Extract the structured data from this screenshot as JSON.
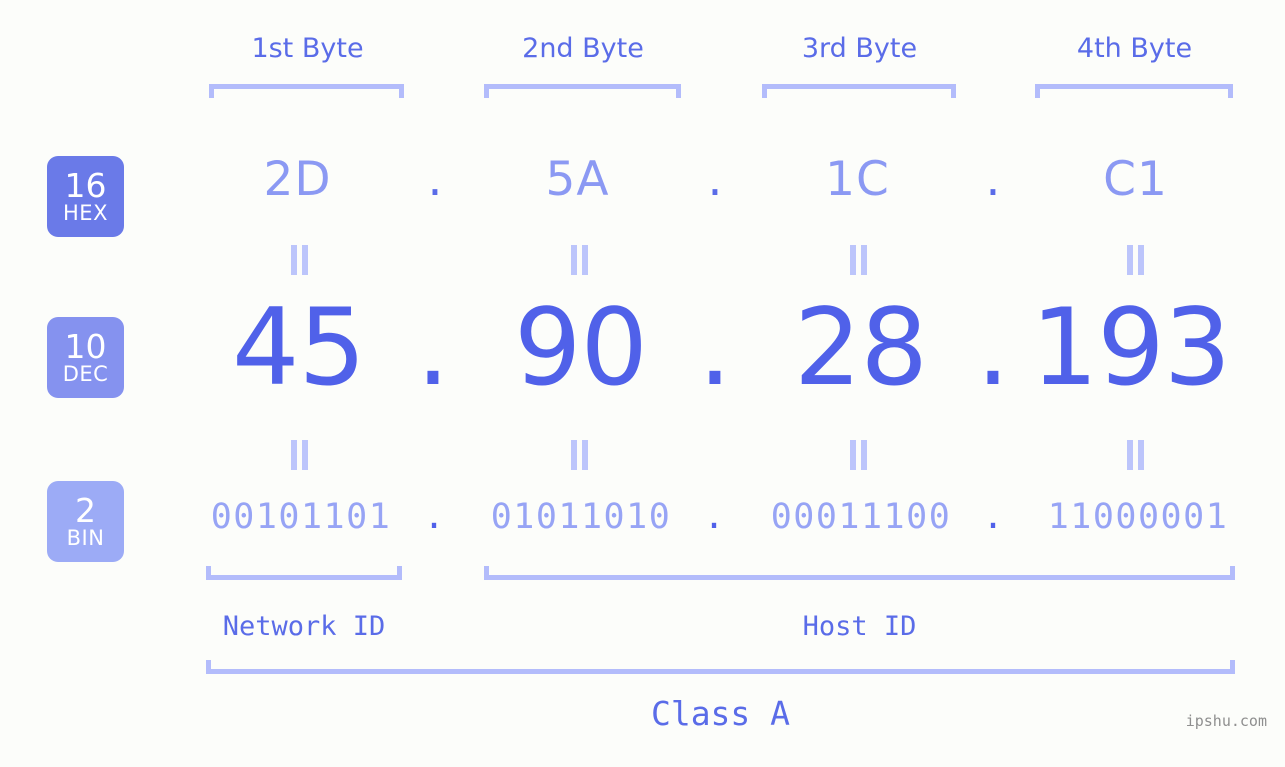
{
  "watermark": "ipshu.com",
  "colors": {
    "background": "#fcfdfa",
    "accent_strong": "#5061e9",
    "accent_mid": "#5a6ce8",
    "accent_soft": "#8b99f3",
    "accent_pale": "#b3bcfb",
    "badge_hex": "#6a7ae8",
    "badge_dec": "#8592ef",
    "badge_bin": "#9cabf6"
  },
  "byte_headers": [
    {
      "label": "1st Byte"
    },
    {
      "label": "2nd Byte"
    },
    {
      "label": "3rd Byte"
    },
    {
      "label": "4th Byte"
    }
  ],
  "bases": [
    {
      "number": "16",
      "name": "HEX"
    },
    {
      "number": "10",
      "name": "DEC"
    },
    {
      "number": "2",
      "name": "BIN"
    }
  ],
  "separator": ".",
  "connector": "||",
  "rows": {
    "hex": {
      "values": [
        "2D",
        "5A",
        "1C",
        "C1"
      ]
    },
    "dec": {
      "values": [
        "45",
        "90",
        "28",
        "193"
      ]
    },
    "bin": {
      "values": [
        "00101101",
        "01011010",
        "00011100",
        "11000001"
      ]
    }
  },
  "segments": {
    "network_id": "Network ID",
    "host_id": "Host ID",
    "class": "Class A"
  }
}
